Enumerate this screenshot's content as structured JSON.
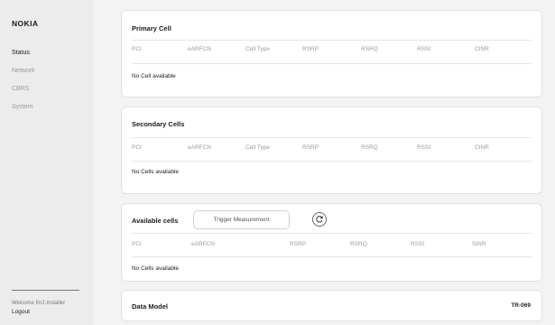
{
  "sidebar": {
    "logo": "NOKIA",
    "items": [
      {
        "label": "Status"
      },
      {
        "label": "Network"
      },
      {
        "label": "CBRS"
      },
      {
        "label": "System"
      }
    ],
    "welcome": "Welcome fm2-installer",
    "logout": "Logout"
  },
  "primary": {
    "title": "Primary Cell",
    "columns": [
      "PCI",
      "eARFCN",
      "Cell Type",
      "RSRP",
      "RSRQ",
      "RSSI",
      "CINR"
    ],
    "empty": "No Cell available"
  },
  "secondary": {
    "title": "Secondary Cells",
    "columns": [
      "PCI",
      "eARFCN",
      "Cell Type",
      "RSRP",
      "RSRQ",
      "RSSI",
      "CINR"
    ],
    "empty": "No Cells available"
  },
  "available": {
    "title": "Available cells",
    "button": "Trigger Measurement",
    "columns": [
      "PCI",
      "eARFCN",
      "RSRP",
      "RSRQ",
      "RSSI",
      "SINR"
    ],
    "empty": "No Cells available"
  },
  "datamodel": {
    "title": "Data Model",
    "value": "TR-069"
  },
  "icons": {
    "refresh": "refresh-icon"
  }
}
